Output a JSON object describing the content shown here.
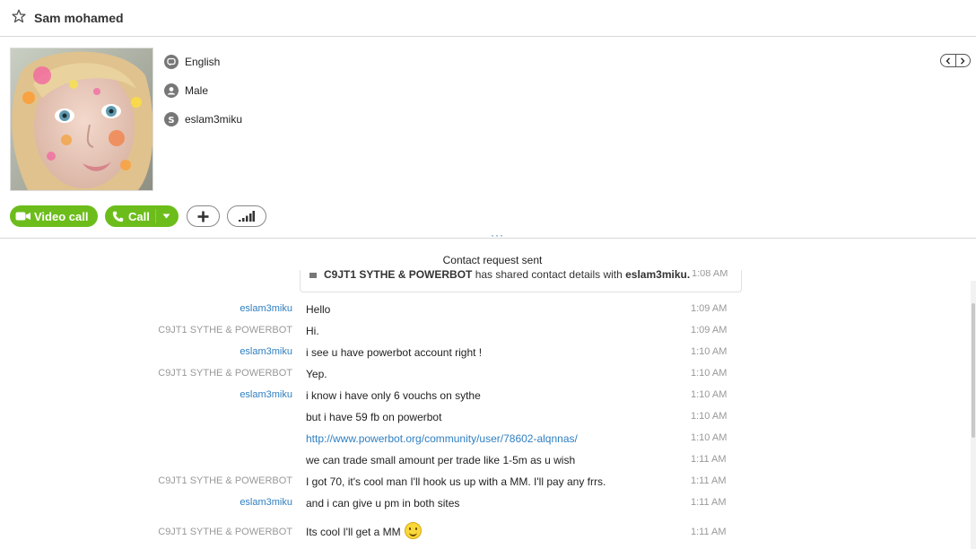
{
  "header": {
    "contact_name": "Sam mohamed"
  },
  "profile": {
    "info": [
      {
        "icon": "speech-bubble-icon",
        "label": "English"
      },
      {
        "icon": "person-icon",
        "label": "Male"
      },
      {
        "icon": "skype-icon",
        "label": "eslam3miku"
      }
    ]
  },
  "actions": {
    "video_call_label": "Video call",
    "call_label": "Call"
  },
  "chat": {
    "status": "Contact request sent",
    "shared_notice": {
      "sender": "C9JT1 SYTHE & POWERBOT",
      "middle": " has shared contact details with ",
      "target": "eslam3miku.",
      "time": "1:08 AM"
    },
    "messages": [
      {
        "sender": "eslam3miku",
        "text": "Hello",
        "time": "1:09 AM"
      },
      {
        "sender": "C9JT1 SYTHE & POWERBOT",
        "text": "Hi.",
        "time": "1:09 AM"
      },
      {
        "sender": "eslam3miku",
        "text": "i see u have powerbot account right !",
        "time": "1:10 AM"
      },
      {
        "sender": "C9JT1 SYTHE & POWERBOT",
        "text": "Yep.",
        "time": "1:10 AM"
      },
      {
        "sender": "eslam3miku",
        "text": "i know i have only 6 vouchs on sythe",
        "time": "1:10 AM"
      },
      {
        "sender": "",
        "text": "but i have 59 fb on powerbot",
        "time": "1:10 AM"
      },
      {
        "sender": "",
        "text": "http://www.powerbot.org/community/user/78602-alqnnas/",
        "time": "1:10 AM"
      },
      {
        "sender": "",
        "text": "we can trade small amount per trade like 1-5m as u wish",
        "time": "1:11 AM"
      },
      {
        "sender": "C9JT1 SYTHE & POWERBOT",
        "text": "I got 70, it's cool man I'll hook us up with a MM. I'll pay any frrs.",
        "time": "1:11 AM"
      },
      {
        "sender": "eslam3miku",
        "text": "and i can give u pm in both sites",
        "time": "1:11 AM"
      },
      {
        "sender": "C9JT1 SYTHE & POWERBOT",
        "text": "Its cool I'll get a MM",
        "time": "1:11 AM"
      }
    ]
  },
  "colors": {
    "accent_green": "#6cbd1b",
    "link_blue": "#2f7fc1"
  }
}
